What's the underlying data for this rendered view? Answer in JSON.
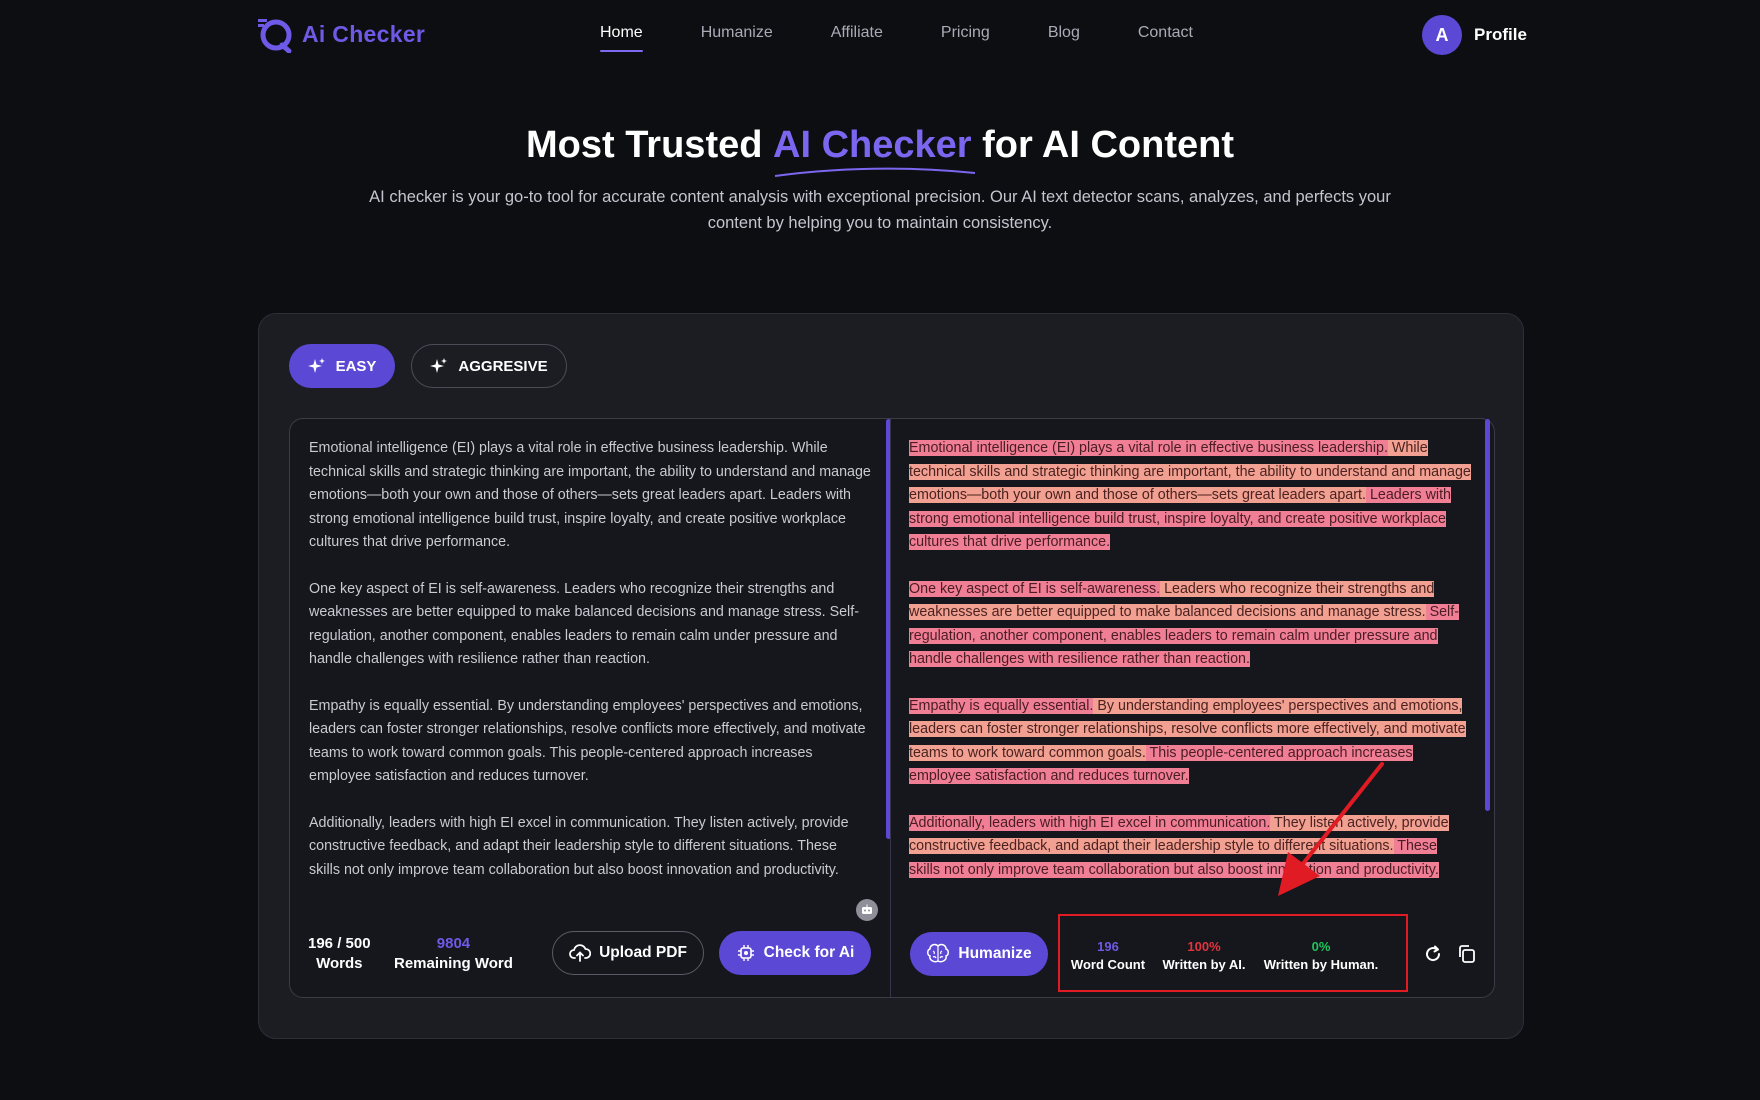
{
  "nav": {
    "brand": "Ai Checker",
    "links": [
      "Home",
      "Humanize",
      "Affiliate",
      "Pricing",
      "Blog",
      "Contact"
    ],
    "active": "Home",
    "profile_initial": "A",
    "profile_label": "Profile"
  },
  "hero": {
    "title_before": "Most Trusted ",
    "title_accent": "AI Checker",
    "title_after": " for AI Content",
    "subtitle": "AI checker is your go-to tool for accurate content analysis with exceptional precision. Our AI text detector scans, analyzes, and perfects your content by helping you to maintain consistency."
  },
  "modes": {
    "easy": "EASY",
    "aggressive": "AGGRESIVE",
    "selected": "EASY"
  },
  "input_text": [
    "Emotional intelligence (EI) plays a vital role in effective business leadership. While technical skills and strategic thinking are important, the ability to understand and manage emotions—both your own and those of others—sets great leaders apart. Leaders with strong emotional intelligence build trust, inspire loyalty, and create positive workplace cultures that drive performance.",
    "One key aspect of EI is self-awareness. Leaders who recognize their strengths and weaknesses are better equipped to make balanced decisions and manage stress. Self-regulation, another component, enables leaders to remain calm under pressure and handle challenges with resilience rather than reaction.",
    "Empathy is equally essential. By understanding employees' perspectives and emotions, leaders can foster stronger relationships, resolve conflicts more effectively, and motivate teams to work toward common goals. This people-centered approach increases employee satisfaction and reduces turnover.",
    "Additionally, leaders with high EI excel in communication. They listen actively, provide constructive feedback, and adapt their leadership style to different situations. These skills not only improve team collaboration but also boost innovation and productivity."
  ],
  "output_segments": [
    [
      "Emotional intelligence (EI) plays a vital role in effective business leadership.",
      " While technical skills and strategic thinking are important, the ability to understand and manage emotions—both your own and those of others—sets great leaders apart.",
      " Leaders with strong emotional intelligence build trust, inspire loyalty, and create positive workplace cultures that drive performance."
    ],
    [
      "One key aspect of EI is self-awareness.",
      " Leaders who recognize their strengths and weaknesses are better equipped to make balanced decisions and manage stress.",
      " Self-regulation, another component, enables leaders to remain calm under pressure and handle challenges with resilience rather than reaction."
    ],
    [
      "Empathy is equally essential.",
      " By understanding employees' perspectives and emotions, leaders can foster stronger relationships, resolve conflicts more effectively, and motivate teams to work toward common goals.",
      " This people-centered approach increases employee satisfaction and reduces turnover."
    ],
    [
      "Additionally, leaders with high EI excel in communication.",
      " They listen actively, provide constructive feedback, and adapt their leadership style to different situations.",
      " These skills not only improve team collaboration but also boost innovation and productivity."
    ]
  ],
  "input_footer": {
    "words_value": "196 / 500",
    "words_label": "Words",
    "remaining_value": "9804",
    "remaining_label": "Remaining Word",
    "upload_label": "Upload PDF",
    "check_label": "Check for Ai"
  },
  "output_footer": {
    "humanize_label": "Humanize",
    "word_count_value": "196",
    "word_count_label": "Word Count",
    "ai_value": "100%",
    "ai_label": "Written by AI.",
    "human_value": "0%",
    "human_label": "Written by Human."
  },
  "colors": {
    "accent": "#5b49d6",
    "highlight_pink": "#f07f96",
    "highlight_salmon": "#f2a091",
    "ai_red": "#e0343f",
    "human_green": "#20c35c",
    "annotation_red": "#e01b24"
  },
  "icons": [
    "sparkle-icon",
    "cloud-upload-icon",
    "chip-icon",
    "brain-icon",
    "refresh-icon",
    "copy-icon",
    "robot-icon"
  ]
}
